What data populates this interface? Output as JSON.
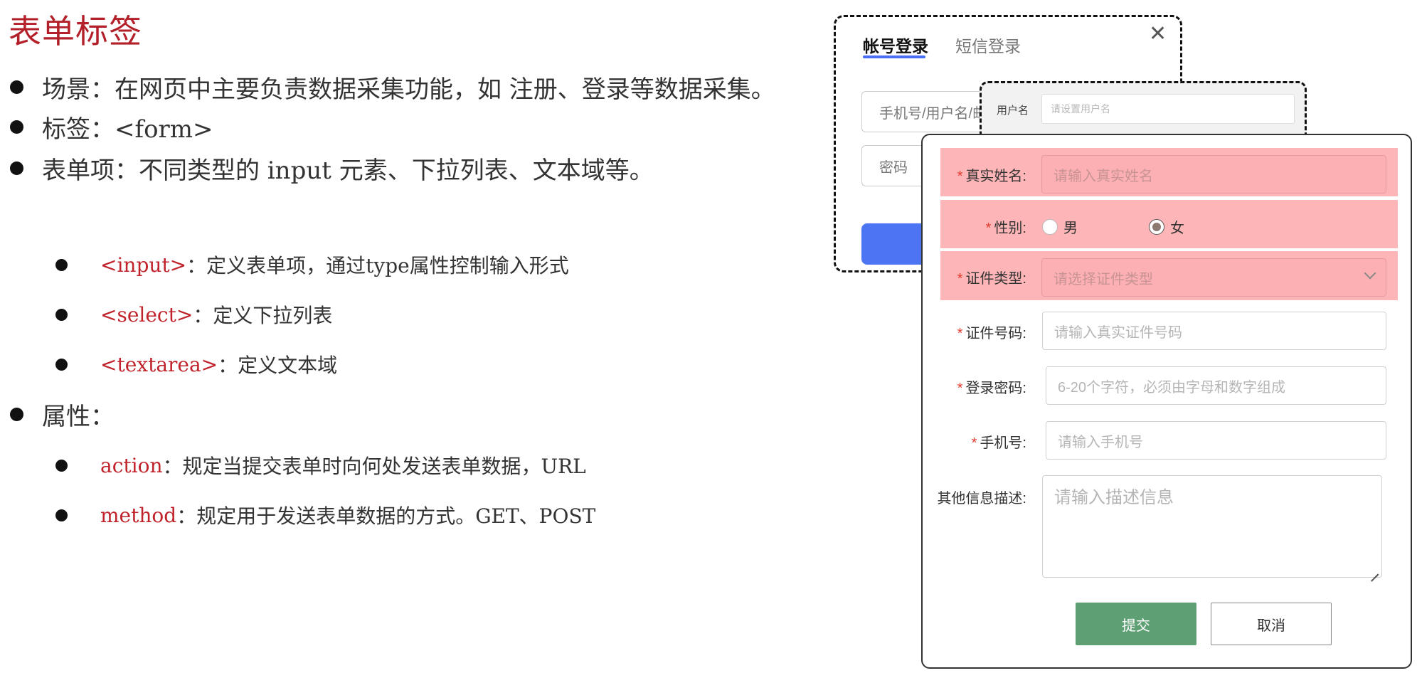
{
  "title": "表单标签",
  "bullets": [
    {
      "text": "场景：在网页中主要负责数据采集功能，如 注册、登录等数据采集。"
    },
    {
      "text": "标签：<form>"
    },
    {
      "text": "表单项：不同类型的 input 元素、下拉列表、文本域等。"
    },
    {
      "code": "<input>",
      "text": "：定义表单项，通过type属性控制输入形式"
    },
    {
      "code": "<select>",
      "text": "：定义下拉列表"
    },
    {
      "code": "<textarea>",
      "text": "：定义文本域"
    },
    {
      "text": "属性："
    },
    {
      "code": "action",
      "text": "：规定当提交表单时向何处发送表单数据，URL"
    },
    {
      "code": "method",
      "text": "：规定用于发送表单数据的方式。GET、POST"
    }
  ],
  "login_card": {
    "tab_account": "帐号登录",
    "tab_sms": "短信登录",
    "username_placeholder": "手机号/用户名/邮箱",
    "password_placeholder": "密码"
  },
  "mini_card": {
    "label": "用户名",
    "placeholder": "请设置用户名"
  },
  "reg_form": {
    "required_mark": "*",
    "realname_label": "真实姓名:",
    "realname_placeholder": "请输入真实姓名",
    "gender_label": "性别:",
    "gender_options": [
      "男",
      "女"
    ],
    "gender_selected": "女",
    "idtype_label": "证件类型:",
    "idtype_placeholder": "请选择证件类型",
    "idnumber_label": "证件号码:",
    "idnumber_placeholder": "请输入真实证件号码",
    "password_label": "登录密码:",
    "password_placeholder": "6-20个字符，必须由字母和数字组成",
    "phone_label": "手机号:",
    "phone_placeholder": "请输入手机号",
    "desc_label": "其他信息描述:",
    "desc_placeholder": "请输入描述信息",
    "submit_label": "提交",
    "cancel_label": "取消"
  },
  "colors": {
    "title_red": "#b3202a",
    "code_red": "#c0232b",
    "highlight": "#fdb5b7",
    "login_button": "#4c74f3",
    "submit_button": "#5e9f74"
  }
}
